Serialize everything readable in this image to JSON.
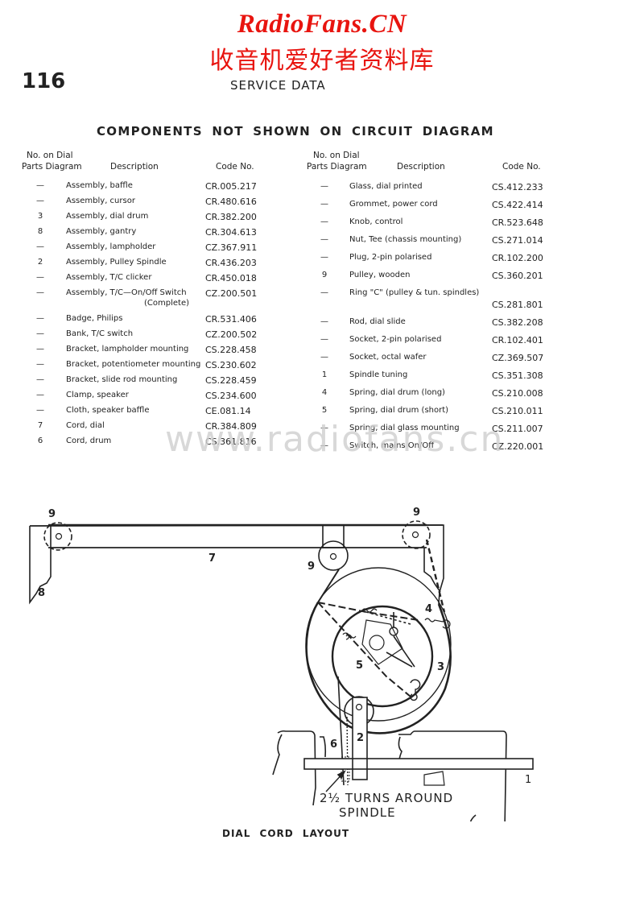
{
  "watermark_header": {
    "brand": "RadioFans.CN",
    "brand_cn": "收音机爱好者资料库"
  },
  "page": {
    "number": "116",
    "section": "SERVICE DATA",
    "title": "COMPONENTS NOT SHOWN ON CIRCUIT DIAGRAM"
  },
  "table_headers": {
    "no_line1": "No. on Dial",
    "no_line2": "Parts Diagram",
    "description": "Description",
    "code": "Code No."
  },
  "left_parts": [
    {
      "no": "—",
      "description": "Assembly, baffle",
      "code": "CR.005.217"
    },
    {
      "no": "—",
      "description": "Assembly, cursor",
      "code": "CR.480.616"
    },
    {
      "no": "3",
      "description": "Assembly, dial drum",
      "code": "CR.382.200"
    },
    {
      "no": "8",
      "description": "Assembly, gantry",
      "code": "CR.304.613"
    },
    {
      "no": "—",
      "description": "Assembly, lampholder",
      "code": "CZ.367.911"
    },
    {
      "no": "2",
      "description": "Assembly, Pulley Spindle",
      "code": "CR.436.203"
    },
    {
      "no": "—",
      "description": "Assembly, T/C clicker",
      "code": "CR.450.018"
    },
    {
      "no": "—",
      "description": "Assembly, T/C—On/Off Switch",
      "description_line2": "(Complete)",
      "code": "CZ.200.501"
    },
    {
      "no": "—",
      "description": "Badge, Philips",
      "code": "CR.531.406"
    },
    {
      "no": "—",
      "description": "Bank, T/C switch",
      "code": "CZ.200.502"
    },
    {
      "no": "—",
      "description": "Bracket, lampholder mounting",
      "code": "CS.228.458"
    },
    {
      "no": "—",
      "description": "Bracket, potentiometer mounting",
      "code": "CS.230.602"
    },
    {
      "no": "—",
      "description": "Bracket, slide rod mounting",
      "code": "CS.228.459"
    },
    {
      "no": "—",
      "description": "Clamp, speaker",
      "code": "CS.234.600"
    },
    {
      "no": "—",
      "description": "Cloth, speaker baffle",
      "code": "CE.081.14"
    },
    {
      "no": "7",
      "description": "Cord, dial",
      "code": "CR.384.809"
    },
    {
      "no": "6",
      "description": "Cord, drum",
      "code": "CS.361.816"
    }
  ],
  "right_parts": [
    {
      "no": "—",
      "description": "Glass, dial printed",
      "code": "CS.412.233"
    },
    {
      "no": "—",
      "description": "Grommet, power cord",
      "code": "CS.422.414"
    },
    {
      "no": "—",
      "description": "Knob, control",
      "code": "CR.523.648"
    },
    {
      "no": "—",
      "description": "Nut, Tee (chassis mounting)",
      "code": "CS.271.014"
    },
    {
      "no": "—",
      "description": "Plug, 2-pin polarised",
      "code": "CR.102.200"
    },
    {
      "no": "9",
      "description": "Pulley, wooden",
      "code": "CS.360.201"
    },
    {
      "no": "—",
      "description": "Ring \"C\" (pulley & tun. spindles)",
      "code": "CS.281.801",
      "code_on_next_line": true
    },
    {
      "no": "—",
      "description": "Rod, dial slide",
      "code": "CS.382.208"
    },
    {
      "no": "—",
      "description": "Socket, 2-pin polarised",
      "code": "CR.102.401"
    },
    {
      "no": "—",
      "description": "Socket, octal wafer",
      "code": "CZ.369.507"
    },
    {
      "no": "1",
      "description": "Spindle tuning",
      "code": "CS.351.308"
    },
    {
      "no": "4",
      "description": "Spring, dial drum (long)",
      "code": "CS.210.008"
    },
    {
      "no": "5",
      "description": "Spring, dial drum (short)",
      "code": "CS.210.011"
    },
    {
      "no": "—",
      "description": "Spring, dial glass mounting",
      "code": "CS.211.007"
    },
    {
      "no": "—",
      "description": "Switch, mains On/Off",
      "code": "CZ.220.001"
    }
  ],
  "watermark": "www.radiofans.cn",
  "diagram": {
    "labels": {
      "pulley_left": "9",
      "pulley_mid": "9",
      "pulley_right": "9",
      "cord": "7",
      "gantry": "8",
      "spring_long": "4",
      "spring_short": "5",
      "drum": "3",
      "pulley_spindle": "2",
      "drum_cord": "6",
      "spindle": "1"
    },
    "annotation_line1": "2½ TURNS AROUND",
    "annotation_line2": "SPINDLE",
    "caption": "DIAL CORD LAYOUT"
  }
}
